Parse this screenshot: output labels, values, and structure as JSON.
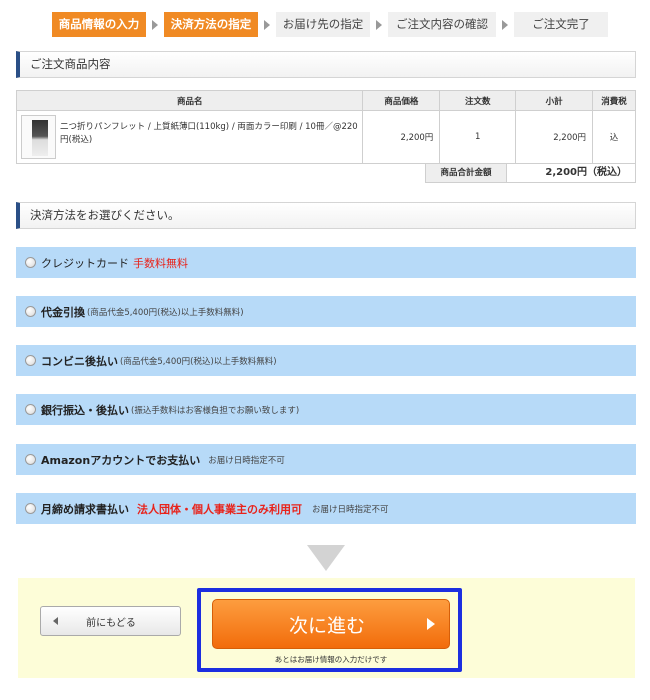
{
  "steps": [
    {
      "label": "商品情報の入力",
      "active": true
    },
    {
      "label": "決済方法の指定",
      "active": true
    },
    {
      "label": "お届け先の指定",
      "active": false
    },
    {
      "label": "ご注文内容の確認",
      "active": false
    },
    {
      "label": "ご注文完了",
      "active": false
    }
  ],
  "order_section": {
    "title": "ご注文商品内容"
  },
  "order_table": {
    "headers": [
      "商品名",
      "商品価格",
      "注文数",
      "小計",
      "消費税"
    ],
    "row": {
      "name": "二つ折りパンフレット / 上質紙薄口(110kg) / 両面カラー印刷 / 10冊／@220円(税込)",
      "price": "2,200円",
      "qty": "1",
      "subtotal": "2,200円",
      "tax": "込"
    },
    "total_label": "商品合計金額",
    "total_value": "2,200円（税込）"
  },
  "payment_section": {
    "title": "決済方法をお選びください。"
  },
  "payments": {
    "credit": {
      "label": "クレジットカード",
      "note": "手数料無料"
    },
    "cod": {
      "label": "代金引換",
      "note": "(商品代金5,400円(税込)以上手数料無料)"
    },
    "konbini": {
      "label": "コンビニ後払い",
      "note": "(商品代金5,400円(税込)以上手数料無料)"
    },
    "bank": {
      "label": "銀行振込・後払い",
      "note": "(振込手数料はお客様負担でお願い致します)"
    },
    "amazon": {
      "label": "Amazonアカウントでお支払い",
      "note": "お届け日時指定不可"
    },
    "monthly": {
      "label": "月締め請求書払い",
      "red": "法人団体・個人事業主のみ利用可",
      "note": "お届け日時指定不可"
    }
  },
  "footer": {
    "back_label": "前にもどる",
    "next_label": "次に進む",
    "next_sub": "あとはお届け情報の入力だけです"
  },
  "colors": {
    "accent": "#f08a24",
    "option_bg": "#b7daf8",
    "highlight": "#1c2ee0",
    "red": "#e8231b"
  }
}
